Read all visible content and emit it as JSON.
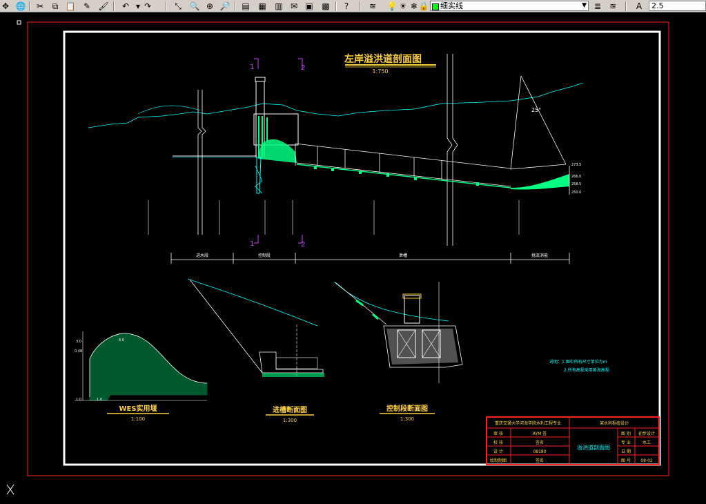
{
  "toolbar": {
    "layer_value": "细实线",
    "text_height": "2.5",
    "icons": [
      "pan-icon",
      "globe-icon",
      "cut-icon",
      "copy-icon",
      "paste-icon",
      "brush-icon",
      "match-properties-icon",
      "undo-icon",
      "redo-icon",
      "track-icon",
      "zoom-realtime-icon",
      "zoom-window-icon",
      "zoom-previous-icon",
      "properties-icon",
      "design-center-icon",
      "tool-palette-icon",
      "markup-icon",
      "calculator-icon",
      "help-icon",
      "layers-icon",
      "lightbulb-icon",
      "sun-icon",
      "lock-icon",
      "text-style-icon"
    ]
  },
  "drawing": {
    "main_title": "左岸溢洪道剖面图",
    "main_scale": "1:750",
    "section_mark_1": "1",
    "section_mark_2": "2",
    "section_mark_1b": "1",
    "section_mark_2b": "2",
    "slope_angle": "25°",
    "elev_right": [
      "273.5",
      "266.0",
      "258.5",
      "250.0"
    ],
    "sub1_title": "WES实用堰",
    "sub1_scale": "1:100",
    "sub2_title": "进槽断面图",
    "sub2_scale": "1:300",
    "sub3_title": "控制段断面图",
    "sub3_scale": "1:300",
    "notes": [
      "说明：1.图中所有尺寸单位为m",
      "2.所有高程采用黄海高程"
    ],
    "segments": [
      "进水段",
      "控制段",
      "泄槽",
      "挑流消能"
    ],
    "wes_dims": [
      "3.0",
      "0.48",
      "6.0",
      "1.0",
      "1.0"
    ],
    "title_block": {
      "school": "重庆交通大学河海学院水利工程专业",
      "project": "某水利枢纽设计",
      "drawing_name": "溢洪道剖面图",
      "rows_left": [
        [
          "审 核",
          "AYM 签"
        ],
        [
          "校 核",
          "签名"
        ],
        [
          "设 计",
          "08180"
        ],
        [
          "绘制制图",
          "签名"
        ]
      ],
      "rows_right": [
        [
          "图 别",
          "初步设计"
        ],
        [
          "专 业",
          "水工"
        ],
        [
          "日 期",
          ""
        ],
        [
          "图 号",
          "08-02"
        ]
      ]
    }
  }
}
